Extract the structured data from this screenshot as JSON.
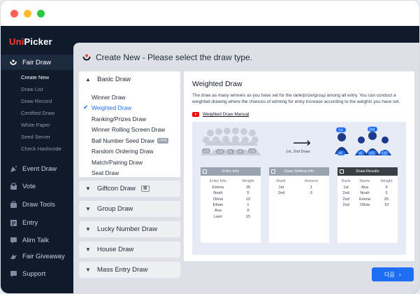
{
  "app": {
    "logo_prefix": "Uni",
    "logo_suffix": "Picker"
  },
  "sidebar": {
    "items": [
      {
        "label": "Fair Draw",
        "icon": "fair-draw-icon"
      },
      {
        "label": "Event Draw",
        "icon": "event-draw-icon"
      },
      {
        "label": "Vote",
        "icon": "vote-icon"
      },
      {
        "label": "Draw Tools",
        "icon": "tools-icon"
      },
      {
        "label": "Entry",
        "icon": "entry-icon"
      },
      {
        "label": "Alim Talk",
        "icon": "chat-icon"
      },
      {
        "label": "Fair Giveaway",
        "icon": "giveaway-icon"
      },
      {
        "label": "Support",
        "icon": "support-icon"
      }
    ],
    "subitems": [
      "Create New",
      "Draw List",
      "Draw Record",
      "Certified Draw",
      "White Paper",
      "Seed Server",
      "Check Hashcode"
    ]
  },
  "header": {
    "title": "Create New - Please select the draw type."
  },
  "draw_types": {
    "basic": {
      "label": "Basic Draw",
      "options": [
        "Winner Draw",
        "Weighted Draw",
        "Ranking/Prizes Draw",
        "Winner Rolling Screen Draw",
        "Ball Number Seed Draw",
        "Random Ordering Draw",
        "Match/Pairing Draw",
        "Seat Draw"
      ],
      "live_badge": "LIVE"
    },
    "giftcon": {
      "label": "Giftcon Draw"
    },
    "group": {
      "label": "Group Draw"
    },
    "lucky": {
      "label": "Lucky Number Draw"
    },
    "house": {
      "label": "House Draw"
    },
    "mass": {
      "label": "Mass Entry Draw"
    }
  },
  "detail": {
    "title": "Weighted Draw",
    "description": "The draw as many winners as you have set for the rank/prize/group among all entry. You can conduct a weighted drawing where the chances of winning for entry increase according to the weights you have set.",
    "manual_link": "Weighted Draw Manual",
    "illustration": {
      "arrow_label": "1st, 2nd Draw",
      "pool_badges": [
        "x15",
        "x25",
        "x5",
        "x9",
        "x10"
      ],
      "first_label": "1st",
      "second_label": "2nd",
      "first_badges": [
        "x9"
      ],
      "second_badges": [
        "x5",
        "x25",
        "x10"
      ]
    },
    "entry_info": {
      "title": "Entry Info",
      "columns": [
        "Entry Info",
        "Weight"
      ],
      "rows": [
        [
          "Emma",
          "25"
        ],
        [
          "Noah",
          "5"
        ],
        [
          "Olivia",
          "10"
        ],
        [
          "Ethan",
          "1"
        ],
        [
          "Ava",
          "9"
        ],
        [
          "Liam",
          "15"
        ]
      ]
    },
    "setting_info": {
      "title": "Draw Setting Info",
      "columns": [
        "Rank",
        "Amount"
      ],
      "rows": [
        [
          "1st",
          "1"
        ],
        [
          "2nd",
          "3"
        ]
      ]
    },
    "results": {
      "title": "Draw Results",
      "columns": [
        "Rank",
        "Name",
        "Weight"
      ],
      "rows": [
        [
          "1st",
          "Ava",
          "9"
        ],
        [
          "2nd",
          "Noah",
          "5"
        ],
        [
          "2nd",
          "Emma",
          "25"
        ],
        [
          "2nd",
          "Olivia",
          "10"
        ]
      ]
    }
  },
  "next_button": {
    "label": "다음"
  },
  "colors": {
    "accent": "#1d6ef5",
    "sidebar_bg": "#0f1a2b",
    "logo_red": "#ff3b30"
  }
}
